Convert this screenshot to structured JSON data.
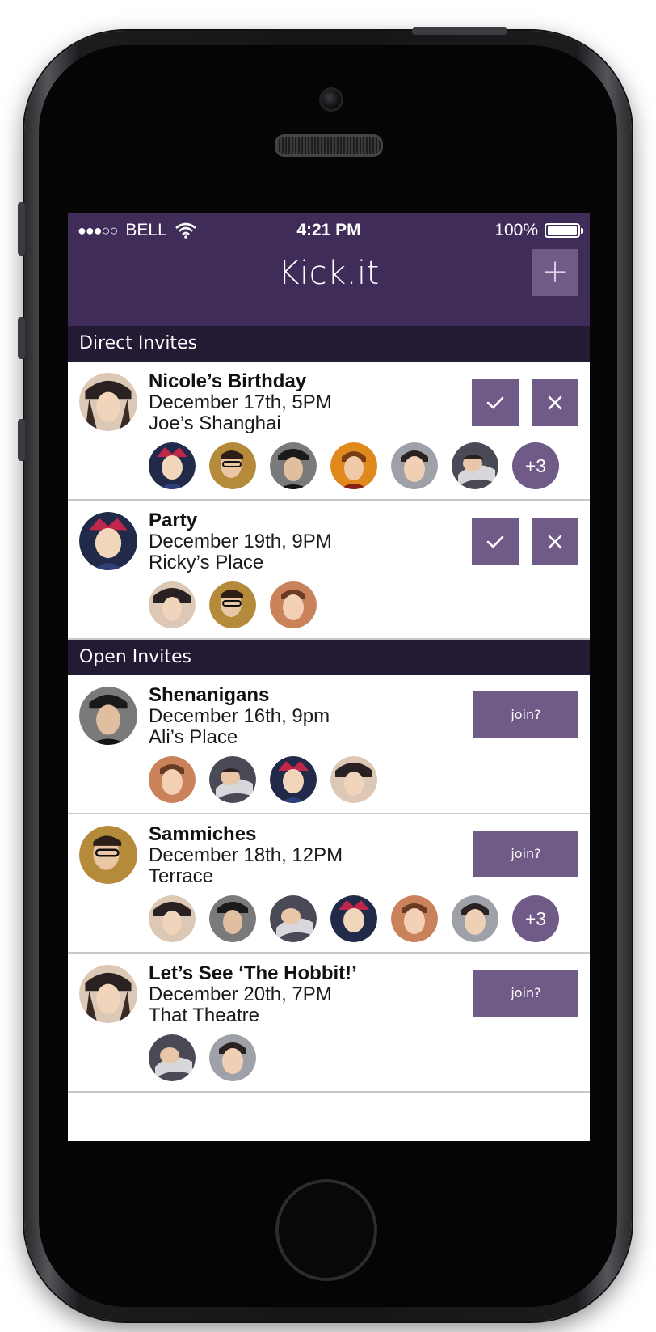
{
  "status_bar": {
    "signal": "●●●○○",
    "carrier": "BELL",
    "time": "4:21 PM",
    "battery": "100%"
  },
  "header": {
    "title": "Kick.it",
    "add_label": "+"
  },
  "colors": {
    "header": "#3f2c59",
    "section": "#231a33",
    "button": "#6f5a88"
  },
  "sections": [
    {
      "label": "Direct Invites",
      "events": [
        {
          "title": "Nicole’s Birthday",
          "date": "December 17th, 5PM",
          "place": "Joe’s Shanghai",
          "more": "+3"
        },
        {
          "title": "Party",
          "date": "December 19th, 9PM",
          "place": "Ricky’s Place"
        }
      ]
    },
    {
      "label": "Open Invites",
      "join_label": "join?",
      "events": [
        {
          "title": "Shenanigans",
          "date": "December 16th, 9pm",
          "place": "Ali’s Place"
        },
        {
          "title": "Sammiches",
          "date": "December 18th, 12PM",
          "place": "Terrace",
          "more": "+3"
        },
        {
          "title": "Let’s See ‘The Hobbit!’",
          "date": "December 20th, 7PM",
          "place": "That Theatre"
        }
      ]
    }
  ]
}
